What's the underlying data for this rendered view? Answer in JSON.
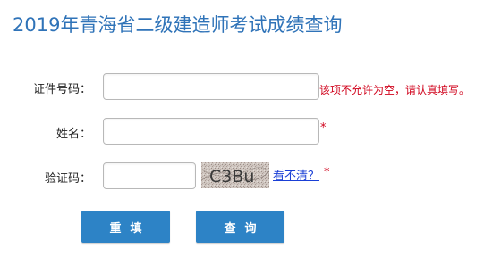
{
  "title": "2019年青海省二级建造师考试成绩查询",
  "form": {
    "id_number": {
      "label": "证件号码：",
      "value": "",
      "hint": "该项不允许为空，请认真填写。"
    },
    "name": {
      "label": "姓名：",
      "value": "",
      "required_mark": "*"
    },
    "captcha": {
      "label": "验证码：",
      "value": "",
      "image_text": "C3Bu",
      "refresh_link": "看不清？",
      "required_mark": "*"
    }
  },
  "buttons": {
    "reset": "重填",
    "query": "查询"
  },
  "colors": {
    "title": "#2f73b8",
    "button": "#2d83c6",
    "error": "#d0021b",
    "link": "#1a3fd6"
  }
}
